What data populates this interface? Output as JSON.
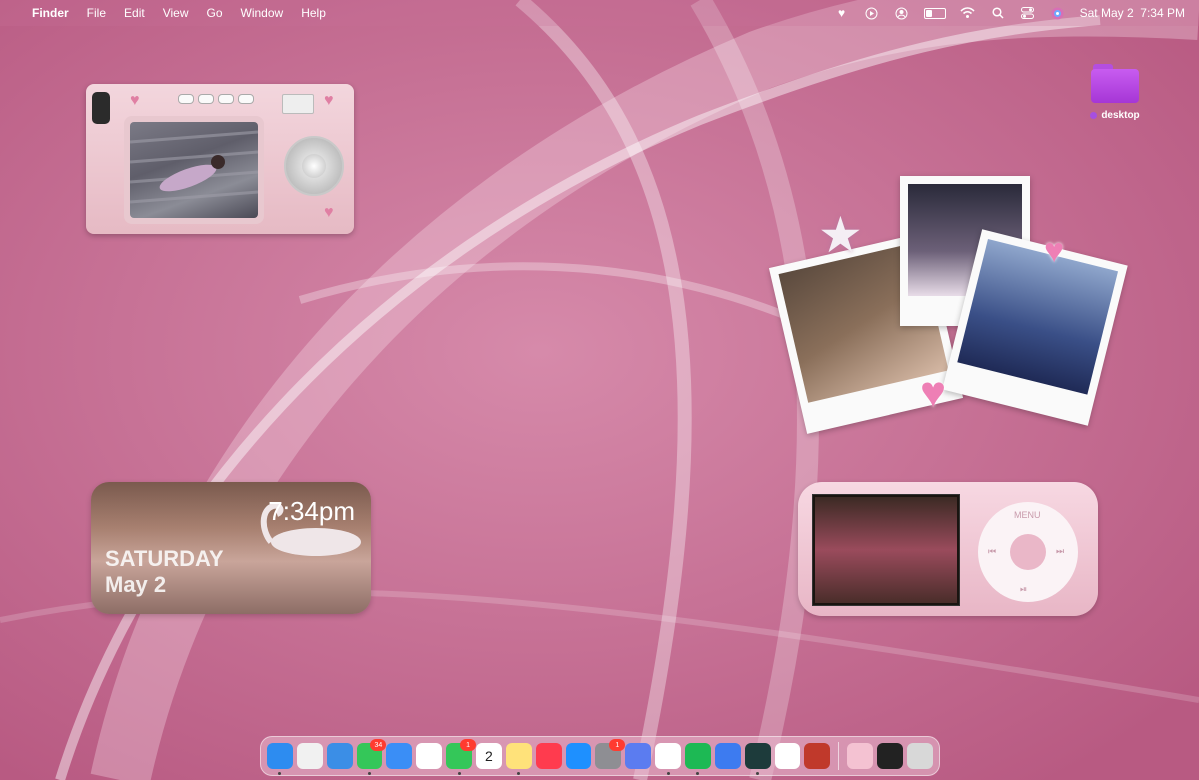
{
  "menubar": {
    "app_name": "Finder",
    "menus": [
      "File",
      "Edit",
      "View",
      "Go",
      "Window",
      "Help"
    ],
    "datetime": "Sat May 2  7:34 PM",
    "battery_level": 0.35,
    "status_icons": [
      "heart-icon",
      "play-icon",
      "user-icon",
      "battery-icon",
      "wifi-icon",
      "search-icon",
      "control-center-icon",
      "siri-icon"
    ]
  },
  "desktop_folder": {
    "label": "desktop",
    "tag_color": "#a64fe0"
  },
  "clock_widget": {
    "time": "7:34pm",
    "day": "SATURDAY",
    "date": "May 2"
  },
  "ipod_widget": {
    "menu_label": "MENU",
    "prev": "⏮",
    "next": "⏭",
    "play_pause": "⏯"
  },
  "dock": {
    "apps": [
      {
        "name": "finder",
        "color": "#2d8cf0",
        "running": true
      },
      {
        "name": "launchpad",
        "color": "#f1f1f1",
        "running": false
      },
      {
        "name": "safari",
        "color": "#3b8ee6",
        "running": false
      },
      {
        "name": "messages",
        "color": "#34c759",
        "badge": "34",
        "running": true
      },
      {
        "name": "mail",
        "color": "#3a8ef6",
        "running": false
      },
      {
        "name": "photos",
        "color": "#ffffff",
        "running": false
      },
      {
        "name": "facetime",
        "color": "#34c759",
        "badge": "1",
        "running": true
      },
      {
        "name": "calendar",
        "color": "#ffffff",
        "label": "2",
        "running": false
      },
      {
        "name": "notes",
        "color": "#ffe27a",
        "running": true
      },
      {
        "name": "news",
        "color": "#ff3b4e",
        "running": false
      },
      {
        "name": "app-store",
        "color": "#1e90ff",
        "running": false
      },
      {
        "name": "system-settings",
        "color": "#8e8e93",
        "badge": "1",
        "running": false
      },
      {
        "name": "simulator",
        "color": "#5b7cf0",
        "running": false
      },
      {
        "name": "chrome",
        "color": "#ffffff",
        "running": true
      },
      {
        "name": "spotify",
        "color": "#1db954",
        "running": true
      },
      {
        "name": "roblox",
        "color": "#3d7bf0",
        "running": false
      },
      {
        "name": "capcut",
        "color": "#1d3b3b",
        "running": true
      },
      {
        "name": "claude",
        "color": "#ffffff",
        "running": false
      },
      {
        "name": "photo-booth",
        "color": "#c0392b",
        "running": false
      }
    ],
    "trailing": [
      {
        "name": "pink-widget-app",
        "color": "#f4c2d2"
      },
      {
        "name": "screenshot-preview",
        "color": "#222222"
      },
      {
        "name": "trash",
        "color": "#d8d8d8"
      }
    ]
  },
  "colors": {
    "wallpaper": "#c86f95",
    "accent": "#e07fa3"
  }
}
